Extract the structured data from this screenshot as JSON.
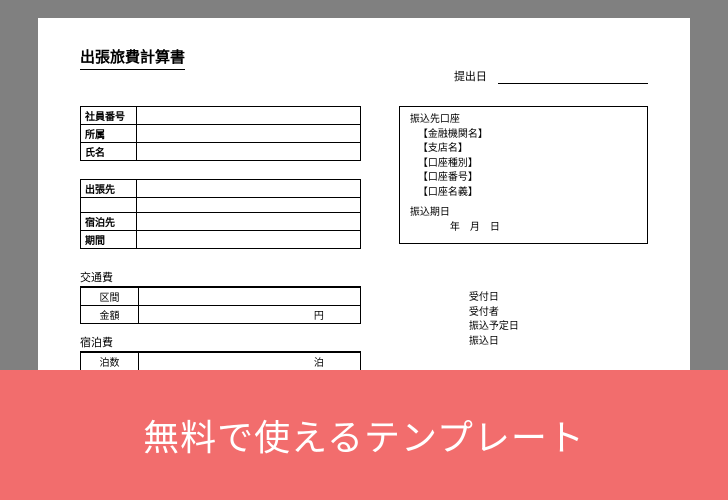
{
  "doc": {
    "title": "出張旅費計算書",
    "submit_label": "提出日"
  },
  "emp": {
    "id_label": "社員番号",
    "dept_label": "所属",
    "name_label": "氏名"
  },
  "trip": {
    "dest_label": "出張先",
    "stay_label": "宿泊先",
    "period_label": "期間"
  },
  "bank": {
    "header": "振込先口座",
    "institution": "【金融機関名】",
    "branch": "【支店名】",
    "acct_type": "【口座種別】",
    "acct_no": "【口座番号】",
    "acct_name": "【口座名義】",
    "due_label": "振込期日",
    "due_value": "年　月　日"
  },
  "transport": {
    "header": "交通費",
    "section_label": "区間",
    "amount_label": "金額",
    "amount_unit": "円"
  },
  "lodging": {
    "header": "宿泊費",
    "nights_label": "泊数",
    "nights_unit": "泊"
  },
  "recv": {
    "recv_date": "受付日",
    "recv_by": "受付者",
    "sched_date": "振込予定日",
    "transfer_date": "振込日"
  },
  "banner": {
    "text": "無料で使えるテンプレート"
  }
}
